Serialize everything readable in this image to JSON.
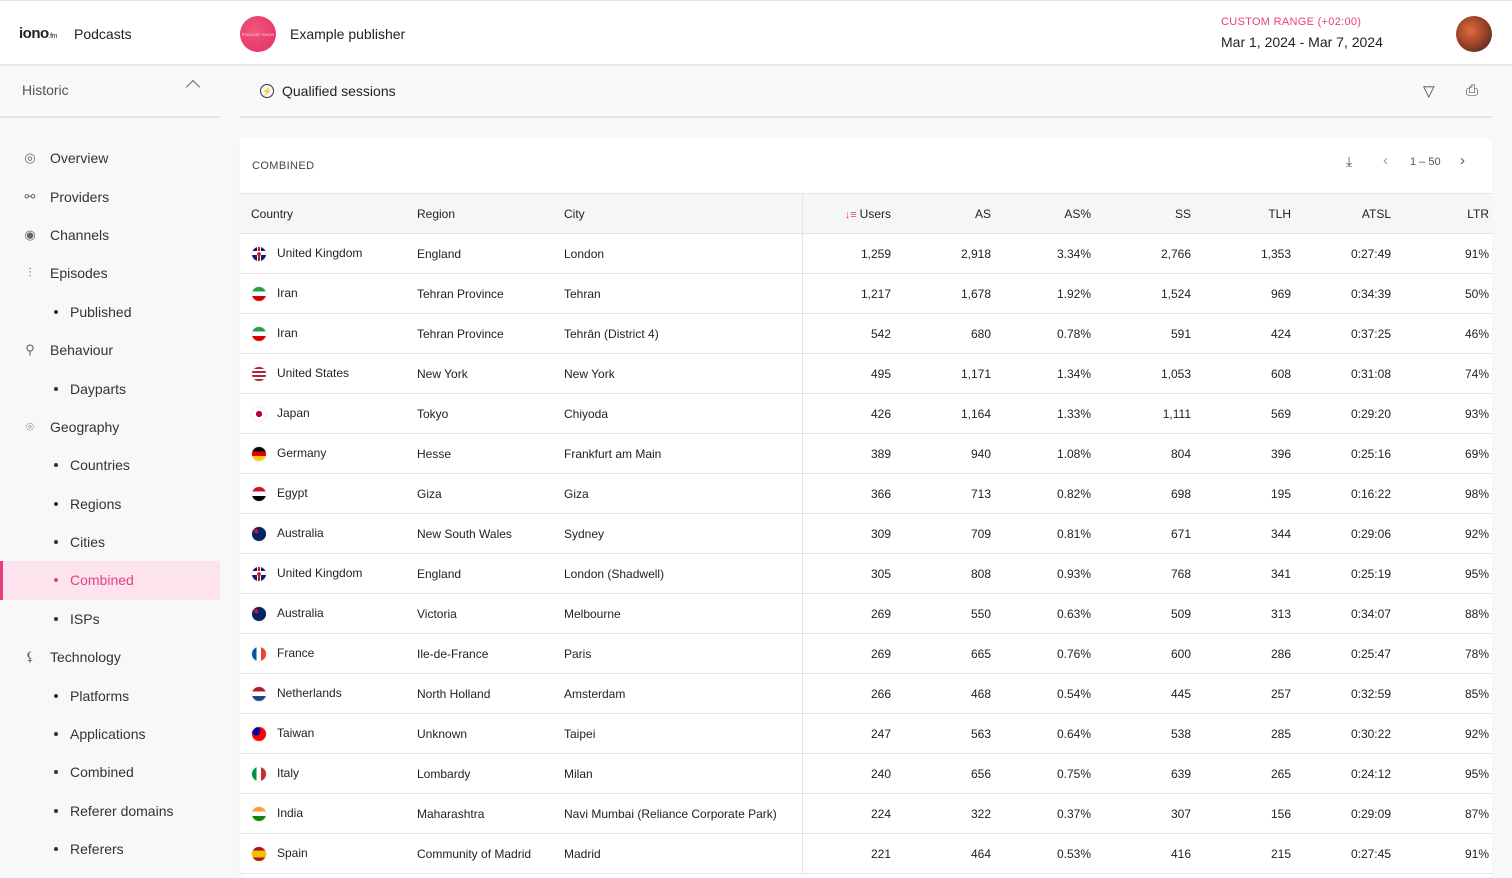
{
  "header": {
    "logo": "iono",
    "logo_suffix": ".fm",
    "app": "Podcasts",
    "publisher": "Example publisher",
    "range_label": "CUSTOM RANGE (+02:00)",
    "range_value": "Mar 1, 2024 - Mar 7, 2024"
  },
  "sidebar": {
    "section": "Historic",
    "items": [
      {
        "label": "Overview",
        "icon": "overview-icon",
        "glyph": "◎"
      },
      {
        "label": "Providers",
        "icon": "providers-icon",
        "glyph": "⚯"
      },
      {
        "label": "Channels",
        "icon": "channels-icon",
        "glyph": "◉"
      },
      {
        "label": "Episodes",
        "icon": "episodes-icon",
        "glyph": "⫶"
      },
      {
        "label": "Published",
        "sub": true
      },
      {
        "label": "Behaviour",
        "icon": "behaviour-icon",
        "glyph": "⚲"
      },
      {
        "label": "Dayparts",
        "sub": true
      },
      {
        "label": "Geography",
        "icon": "location-pin-icon",
        "glyph": "⌾"
      },
      {
        "label": "Countries",
        "sub": true
      },
      {
        "label": "Regions",
        "sub": true
      },
      {
        "label": "Cities",
        "sub": true
      },
      {
        "label": "Combined",
        "sub": true,
        "active": true
      },
      {
        "label": "ISPs",
        "sub": true
      },
      {
        "label": "Technology",
        "icon": "technology-icon",
        "glyph": "⚸"
      },
      {
        "label": "Platforms",
        "sub": true
      },
      {
        "label": "Applications",
        "sub": true
      },
      {
        "label": "Combined",
        "sub": true
      },
      {
        "label": "Referer domains",
        "sub": true
      },
      {
        "label": "Referers",
        "sub": true
      }
    ]
  },
  "toolbar": {
    "title": "Qualified sessions"
  },
  "card": {
    "title": "COMBINED",
    "pager": "1 – 50"
  },
  "accent": "#e8407f",
  "table": {
    "columns": [
      "Country",
      "Region",
      "City",
      "Users",
      "AS",
      "AS%",
      "SS",
      "TLH",
      "ATSL",
      "LTR"
    ],
    "sorted_column": "Users",
    "rows": [
      [
        "gb",
        "United Kingdom",
        "England",
        "London",
        "1,259",
        "2,918",
        "3.34%",
        "2,766",
        "1,353",
        "0:27:49",
        "91%"
      ],
      [
        "ir",
        "Iran",
        "Tehran Province",
        "Tehran",
        "1,217",
        "1,678",
        "1.92%",
        "1,524",
        "969",
        "0:34:39",
        "50%"
      ],
      [
        "ir",
        "Iran",
        "Tehran Province",
        "Tehrān (District 4)",
        "542",
        "680",
        "0.78%",
        "591",
        "424",
        "0:37:25",
        "46%"
      ],
      [
        "us",
        "United States",
        "New York",
        "New York",
        "495",
        "1,171",
        "1.34%",
        "1,053",
        "608",
        "0:31:08",
        "74%"
      ],
      [
        "jp",
        "Japan",
        "Tokyo",
        "Chiyoda",
        "426",
        "1,164",
        "1.33%",
        "1,111",
        "569",
        "0:29:20",
        "93%"
      ],
      [
        "de",
        "Germany",
        "Hesse",
        "Frankfurt am Main",
        "389",
        "940",
        "1.08%",
        "804",
        "396",
        "0:25:16",
        "69%"
      ],
      [
        "eg",
        "Egypt",
        "Giza",
        "Giza",
        "366",
        "713",
        "0.82%",
        "698",
        "195",
        "0:16:22",
        "98%"
      ],
      [
        "au",
        "Australia",
        "New South Wales",
        "Sydney",
        "309",
        "709",
        "0.81%",
        "671",
        "344",
        "0:29:06",
        "92%"
      ],
      [
        "gb",
        "United Kingdom",
        "England",
        "London (Shadwell)",
        "305",
        "808",
        "0.93%",
        "768",
        "341",
        "0:25:19",
        "95%"
      ],
      [
        "au",
        "Australia",
        "Victoria",
        "Melbourne",
        "269",
        "550",
        "0.63%",
        "509",
        "313",
        "0:34:07",
        "88%"
      ],
      [
        "fr",
        "France",
        "Ile-de-France",
        "Paris",
        "269",
        "665",
        "0.76%",
        "600",
        "286",
        "0:25:47",
        "78%"
      ],
      [
        "nl",
        "Netherlands",
        "North Holland",
        "Amsterdam",
        "266",
        "468",
        "0.54%",
        "445",
        "257",
        "0:32:59",
        "85%"
      ],
      [
        "tw",
        "Taiwan",
        "Unknown",
        "Taipei",
        "247",
        "563",
        "0.64%",
        "538",
        "285",
        "0:30:22",
        "92%"
      ],
      [
        "it",
        "Italy",
        "Lombardy",
        "Milan",
        "240",
        "656",
        "0.75%",
        "639",
        "265",
        "0:24:12",
        "95%"
      ],
      [
        "in",
        "India",
        "Maharashtra",
        "Navi Mumbai (Reliance Corporate Park)",
        "224",
        "322",
        "0.37%",
        "307",
        "156",
        "0:29:09",
        "87%"
      ],
      [
        "es",
        "Spain",
        "Community of Madrid",
        "Madrid",
        "221",
        "464",
        "0.53%",
        "416",
        "215",
        "0:27:45",
        "91%"
      ]
    ]
  }
}
